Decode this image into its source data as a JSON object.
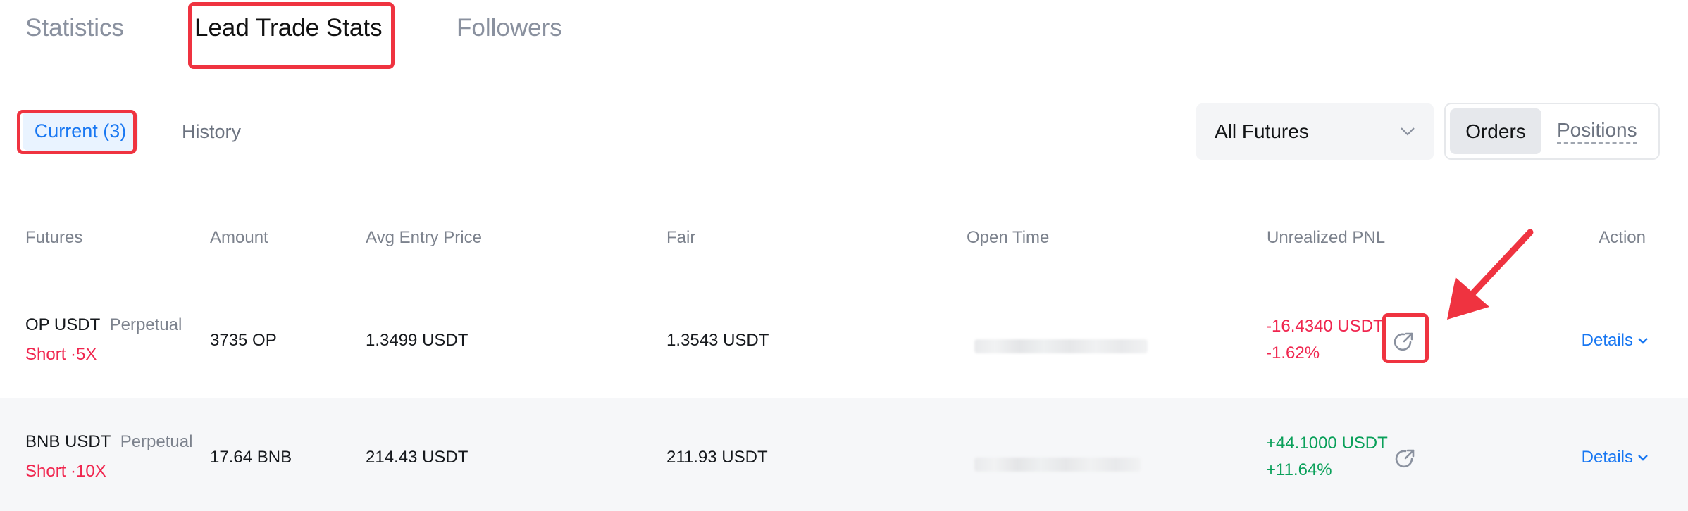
{
  "tabs": {
    "statistics": "Statistics",
    "lead_trade_stats": "Lead Trade Stats",
    "followers": "Followers"
  },
  "subtabs": {
    "current": "Current (3)",
    "history": "History"
  },
  "filter": {
    "selected": "All Futures"
  },
  "view_toggle": {
    "orders": "Orders",
    "positions": "Positions"
  },
  "table": {
    "headers": {
      "futures": "Futures",
      "amount": "Amount",
      "avg_entry_price": "Avg Entry Price",
      "fair": "Fair",
      "open_time": "Open Time",
      "unrealized_pnl": "Unrealized PNL",
      "action": "Action"
    },
    "rows": [
      {
        "pair": "OP USDT",
        "contract": "Perpetual",
        "side": "Short ·5X",
        "amount": "3735 OP",
        "avg_entry_price": "1.3499 USDT",
        "fair": "1.3543 USDT",
        "pnl": "-16.4340 USDT",
        "pnl_pct": "-1.62%",
        "action": "Details"
      },
      {
        "pair": "BNB USDT",
        "contract": "Perpetual",
        "side": "Short ·10X",
        "amount": "17.64 BNB",
        "avg_entry_price": "214.43 USDT",
        "fair": "211.93 USDT",
        "pnl": "+44.1000 USDT",
        "pnl_pct": "+11.64%",
        "action": "Details"
      }
    ]
  },
  "icons": {
    "share": "share-icon",
    "chevron_down": "chevron-down-icon",
    "annotation_arrow": "annotation-arrow-icon"
  },
  "colors": {
    "accent": "#1877f2",
    "negative": "#f0264f",
    "positive": "#0aa05a",
    "annotation": "#ef3340"
  }
}
